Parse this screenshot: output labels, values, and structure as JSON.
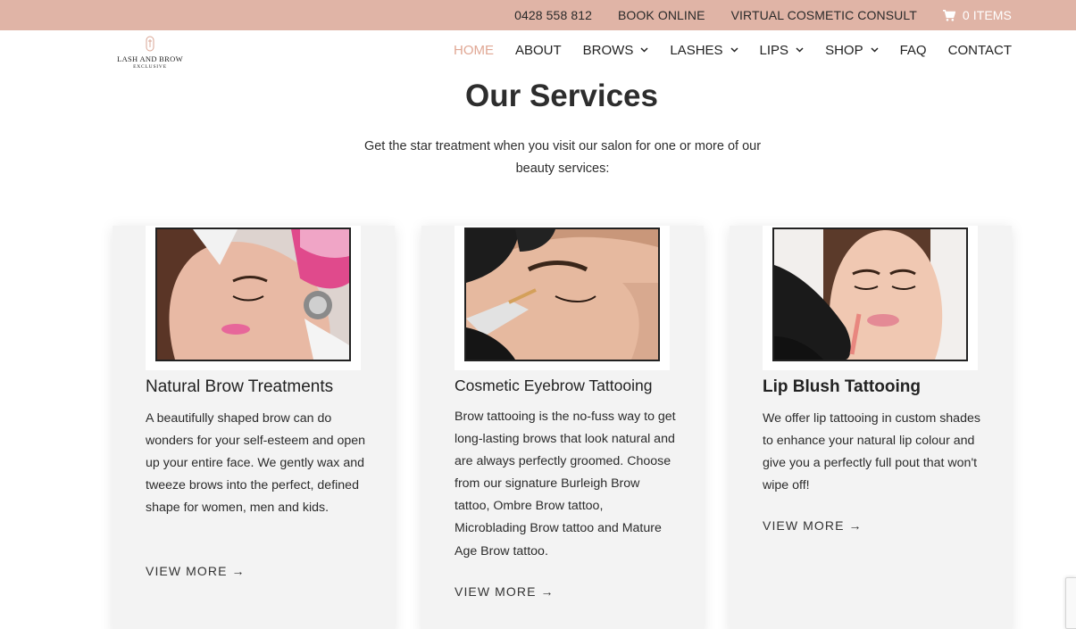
{
  "topbar": {
    "phone": "0428 558 812",
    "book": "BOOK ONLINE",
    "consult": "VIRTUAL COSMETIC CONSULT",
    "cart": "0 ITEMS"
  },
  "logo": {
    "name": "LASH AND BROW",
    "sub": "EXCLUSIVE"
  },
  "nav": {
    "home": "HOME",
    "about": "ABOUT",
    "brows": "BROWS",
    "lashes": "LASHES",
    "lips": "LIPS",
    "shop": "SHOP",
    "faq": "FAQ",
    "contact": "CONTACT"
  },
  "page": {
    "title": "Our Services",
    "intro": "Get the star treatment when you visit our salon for one or more of our beauty services:"
  },
  "cards": [
    {
      "title": "Natural Brow Treatments",
      "text": "A beautifully shaped brow can do wonders for your self-esteem and open up your entire face. We gently wax and tweeze brows into the perfect, defined shape for women, men and kids.",
      "link": "VIEW MORE →"
    },
    {
      "title": "Cosmetic Eyebrow Tattooing",
      "text": "Brow tattooing is the no-fuss way to get long-lasting brows that look natural and are always perfectly groomed. Choose from our signature Burleigh Brow tattoo, Ombre Brow tattoo, Microblading Brow tattoo and Mature Age Brow tattoo.",
      "link": "VIEW MORE →"
    },
    {
      "title": "Lip Blush Tattooing",
      "text": "We offer lip tattooing in custom shades to enhance your natural lip colour and give you a perfectly full pout that won't wipe off!",
      "link": "VIEW MORE →"
    }
  ],
  "colors": {
    "topbar": "#e0b4a6",
    "accent": "#e0a794",
    "card_bg": "#f3f3f3"
  }
}
